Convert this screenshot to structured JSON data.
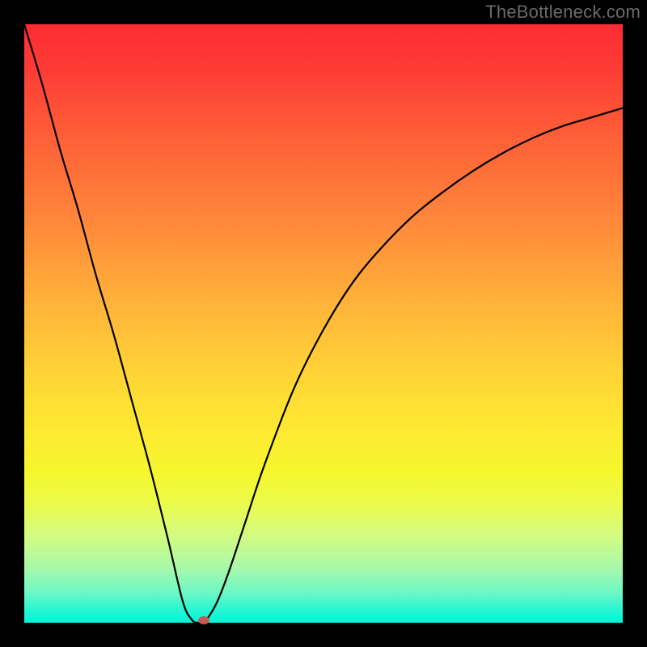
{
  "watermark": "TheBottleneck.com",
  "colors": {
    "background": "#000000",
    "gradient_top": "#fd2b33",
    "gradient_bottom": "#03f4db",
    "curve_stroke": "#000000",
    "marker": "#c85a54"
  },
  "chart_data": {
    "type": "line",
    "title": "",
    "xlabel": "",
    "ylabel": "",
    "xlim": [
      0,
      1
    ],
    "ylim": [
      0,
      1
    ],
    "annotations": [
      {
        "type": "marker",
        "x": 0.3,
        "y": 0.0
      }
    ],
    "series": [
      {
        "name": "bottleneck-curve",
        "x": [
          0.0,
          0.03,
          0.06,
          0.09,
          0.12,
          0.15,
          0.18,
          0.21,
          0.24,
          0.265,
          0.28,
          0.29,
          0.3,
          0.32,
          0.34,
          0.37,
          0.4,
          0.45,
          0.5,
          0.55,
          0.6,
          0.65,
          0.7,
          0.75,
          0.8,
          0.85,
          0.9,
          0.95,
          1.0
        ],
        "y": [
          1.0,
          0.9,
          0.79,
          0.69,
          0.58,
          0.48,
          0.37,
          0.26,
          0.14,
          0.035,
          0.005,
          0.0,
          0.0,
          0.03,
          0.08,
          0.17,
          0.26,
          0.39,
          0.49,
          0.57,
          0.63,
          0.68,
          0.72,
          0.755,
          0.785,
          0.81,
          0.83,
          0.845,
          0.86
        ]
      }
    ]
  }
}
